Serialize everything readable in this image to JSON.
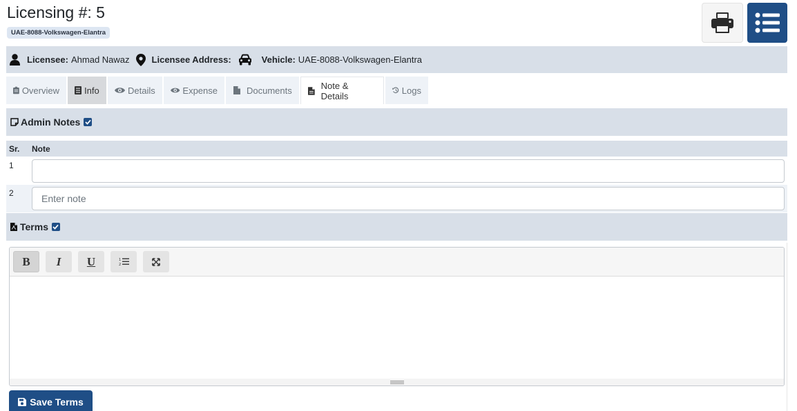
{
  "header": {
    "title": "Licensing #: 5",
    "plate_badge": "UAE-8088-Volkswagen-Elantra"
  },
  "actions": {
    "print_icon": "print-icon",
    "list_icon": "list-icon"
  },
  "info_bar": {
    "licensee_label": "Licensee:",
    "licensee_value": "Ahmad Nawaz",
    "address_label": "Licensee Address:",
    "address_value": "",
    "vehicle_label": "Vehicle:",
    "vehicle_value": "UAE-8088-Volkswagen-Elantra"
  },
  "tabs": [
    {
      "label": "Overview",
      "icon": "clipboard-icon"
    },
    {
      "label": "Info",
      "icon": "file-list-icon"
    },
    {
      "label": "Details",
      "icon": "eye-icon"
    },
    {
      "label": "Expense",
      "icon": "eye-icon"
    },
    {
      "label": "Documents",
      "icon": "file-icon"
    },
    {
      "label": "Note & Details",
      "icon": "file-text-icon"
    },
    {
      "label": "Logs",
      "icon": "history-icon"
    }
  ],
  "admin_notes": {
    "title": "Admin Notes",
    "checked": true,
    "col_sr": "Sr.",
    "col_note": "Note",
    "rows": [
      {
        "sr": "1",
        "value": "",
        "placeholder": ""
      },
      {
        "sr": "2",
        "value": "",
        "placeholder": "Enter note"
      }
    ]
  },
  "terms": {
    "title": "Terms",
    "checked": true,
    "toolbar": {
      "bold": "B",
      "italic": "I",
      "underline": "U"
    },
    "content": ""
  },
  "save_button": {
    "label": "Save Terms"
  },
  "colors": {
    "primary": "#1f4e86",
    "bar_bg": "#d8dfe8",
    "tab_bg": "#eef2f7"
  }
}
